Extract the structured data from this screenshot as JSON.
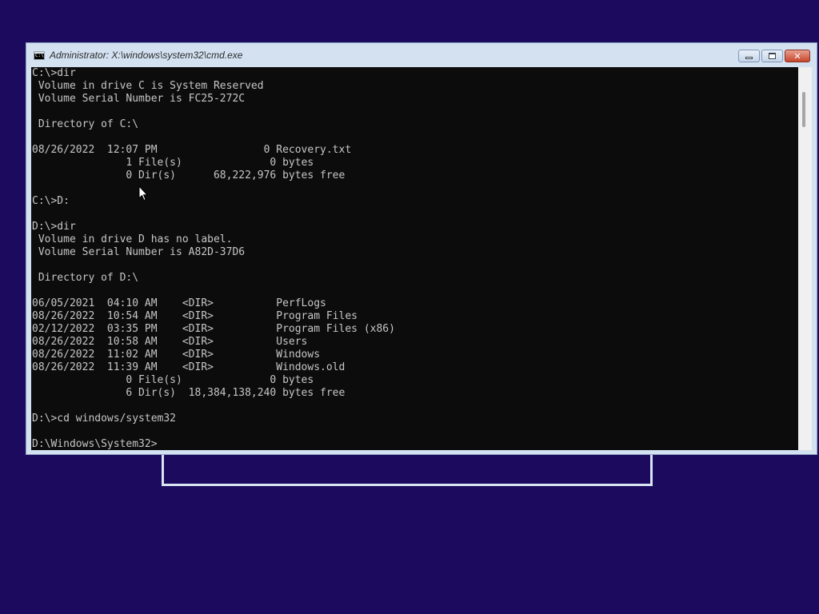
{
  "window": {
    "title": "Administrator: X:\\windows\\system32\\cmd.exe",
    "icon_label": "C:\\",
    "buttons": {
      "minimize": "minimize-icon",
      "maximize": "restore-icon",
      "close": "✕"
    }
  },
  "console": {
    "lines": [
      "C:\\>dir",
      " Volume in drive C is System Reserved",
      " Volume Serial Number is FC25-272C",
      "",
      " Directory of C:\\",
      "",
      "08/26/2022  12:07 PM                 0 Recovery.txt",
      "               1 File(s)              0 bytes",
      "               0 Dir(s)      68,222,976 bytes free",
      "",
      "C:\\>D:",
      "",
      "D:\\>dir",
      " Volume in drive D has no label.",
      " Volume Serial Number is A82D-37D6",
      "",
      " Directory of D:\\",
      "",
      "06/05/2021  04:10 AM    <DIR>          PerfLogs",
      "08/26/2022  10:54 AM    <DIR>          Program Files",
      "02/12/2022  03:35 PM    <DIR>          Program Files (x86)",
      "08/26/2022  10:58 AM    <DIR>          Users",
      "08/26/2022  11:02 AM    <DIR>          Windows",
      "08/26/2022  11:39 AM    <DIR>          Windows.old",
      "               0 File(s)              0 bytes",
      "               6 Dir(s)  18,384,138,240 bytes free",
      "",
      "D:\\>cd windows/system32",
      "",
      "D:\\Windows\\System32>"
    ]
  },
  "colors": {
    "desktop_background": "#1c0a5e",
    "console_background": "#0c0c0c",
    "console_text": "#c6c6c6",
    "window_frame": "#d3e1f1"
  }
}
